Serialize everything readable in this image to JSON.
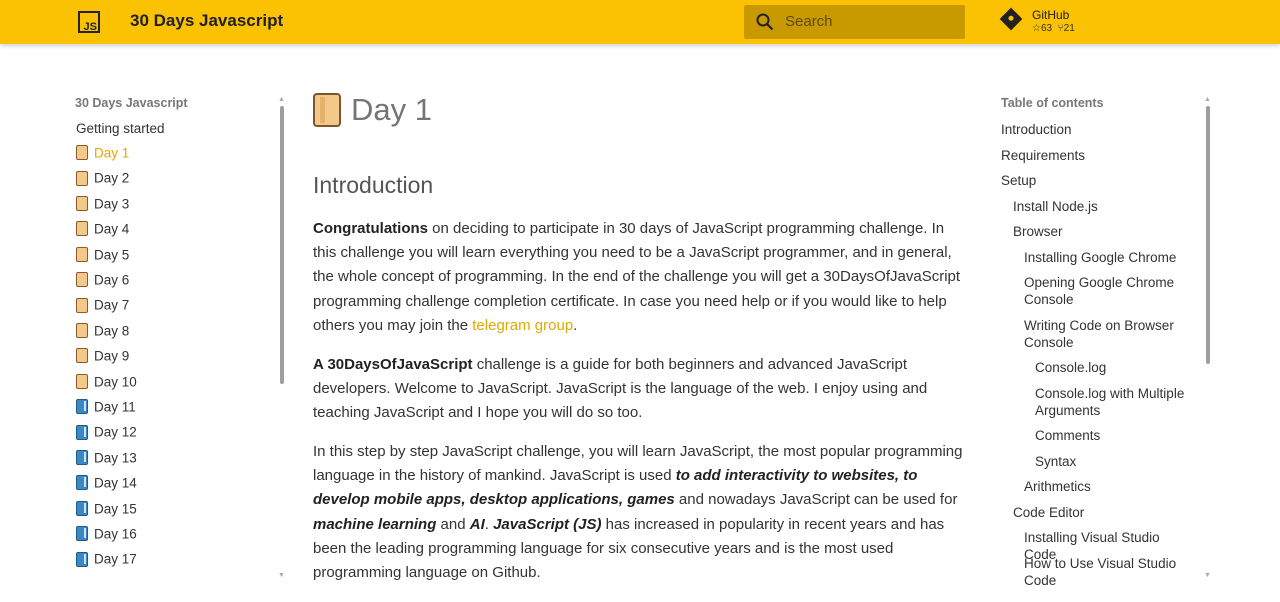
{
  "header": {
    "logo_text": "JS",
    "site_title": "30 Days Javascript",
    "search_placeholder": "Search",
    "repo_name": "GitHub",
    "stars": "63",
    "forks": "21"
  },
  "left_nav": {
    "title": "30 Days Javascript",
    "getting_started": "Getting started",
    "days": [
      {
        "label": "Day 1",
        "active": true,
        "icon": "orange-book-icon"
      },
      {
        "label": "Day 2",
        "icon": "orange-book-icon"
      },
      {
        "label": "Day 3",
        "icon": "orange-book-icon"
      },
      {
        "label": "Day 4",
        "icon": "orange-book-icon"
      },
      {
        "label": "Day 5",
        "icon": "orange-book-icon"
      },
      {
        "label": "Day 6",
        "icon": "orange-book-icon"
      },
      {
        "label": "Day 7",
        "icon": "orange-book-icon"
      },
      {
        "label": "Day 8",
        "icon": "orange-book-icon"
      },
      {
        "label": "Day 9",
        "icon": "orange-book-icon"
      },
      {
        "label": "Day 10",
        "icon": "orange-book-icon"
      },
      {
        "label": "Day 11",
        "icon": "blue-book-icon"
      },
      {
        "label": "Day 12",
        "icon": "blue-book-icon"
      },
      {
        "label": "Day 13",
        "icon": "blue-book-icon"
      },
      {
        "label": "Day 14",
        "icon": "blue-book-icon"
      },
      {
        "label": "Day 15",
        "icon": "blue-book-icon"
      },
      {
        "label": "Day 16",
        "icon": "blue-book-icon"
      },
      {
        "label": "Day 17",
        "icon": "blue-book-icon"
      }
    ]
  },
  "main": {
    "title": "Day 1",
    "section_heading": "Introduction",
    "p1_bold": "Congratulations",
    "p1_text": " on deciding to participate in 30 days of JavaScript programming challenge. In this challenge you will learn everything you need to be a JavaScript programmer, and in general, the whole concept of programming. In the end of the challenge you will get a 30DaysOfJavaScript programming challenge completion certificate. In case you need help or if you would like to help others you may join the ",
    "p1_link": "telegram group",
    "p1_end": ".",
    "p2_bold": "A 30DaysOfJavaScript",
    "p2_text": " challenge is a guide for both beginners and advanced JavaScript developers. Welcome to JavaScript. JavaScript is the language of the web. I enjoy using and teaching JavaScript and I hope you will do so too.",
    "p3_a": "In this step by step JavaScript challenge, you will learn JavaScript, the most popular programming language in the history of mankind. JavaScript is used ",
    "p3_b": "to add interactivity to websites, to develop mobile apps, desktop applications, games",
    "p3_c": " and nowadays JavaScript can be used for ",
    "p3_d": "machine learning",
    "p3_e": " and ",
    "p3_f": "AI",
    "p3_g": ". ",
    "p3_h": "JavaScript (JS)",
    "p3_i": " has increased in popularity in recent years and has been the leading programming language for six consecutive years and is the most used programming language on Github."
  },
  "toc": {
    "title": "Table of contents",
    "items": [
      {
        "label": "Introduction",
        "level": 0
      },
      {
        "label": "Requirements",
        "level": 0
      },
      {
        "label": "Setup",
        "level": 0
      },
      {
        "label": "Install Node.js",
        "level": 1
      },
      {
        "label": "Browser",
        "level": 1
      },
      {
        "label": "Installing Google Chrome",
        "level": 2
      },
      {
        "label": "Opening Google Chrome Console",
        "level": 2
      },
      {
        "label": "Writing Code on Browser Console",
        "level": 2
      },
      {
        "label": "Console.log",
        "level": 3
      },
      {
        "label": "Console.log with Multiple Arguments",
        "level": 3
      },
      {
        "label": "Comments",
        "level": 3
      },
      {
        "label": "Syntax",
        "level": 3
      },
      {
        "label": "Arithmetics",
        "level": 2
      },
      {
        "label": "Code Editor",
        "level": 1
      },
      {
        "label": "Installing Visual Studio Code",
        "level": 2
      },
      {
        "label": "How to Use Visual Studio Code",
        "level": 2
      }
    ]
  },
  "colors": {
    "header_bg": "#fbc103",
    "accent": "#e0a800"
  }
}
